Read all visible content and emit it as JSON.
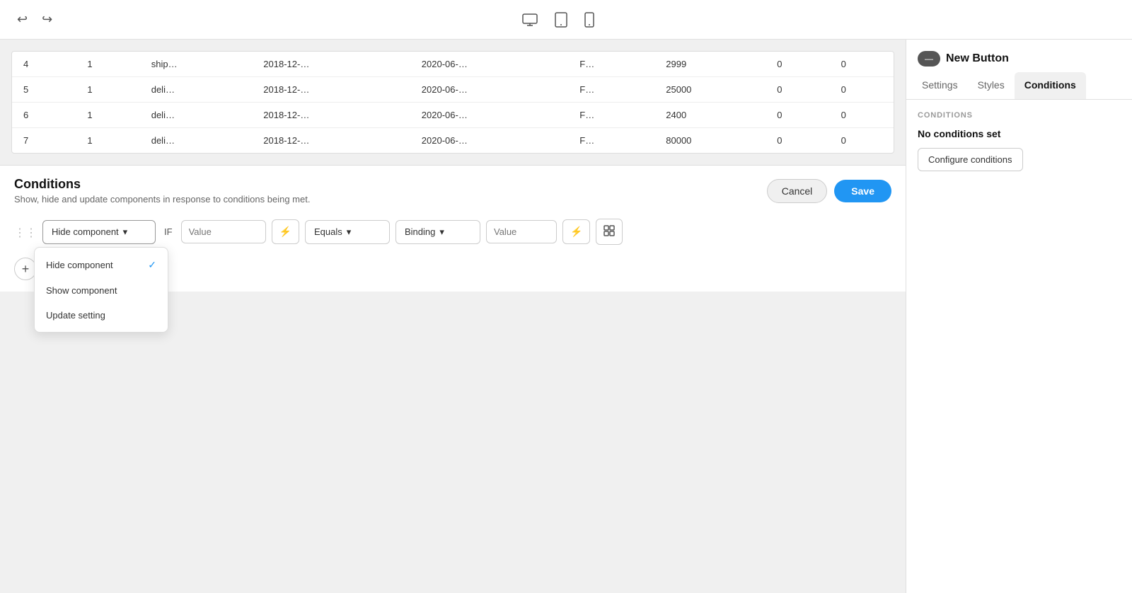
{
  "toolbar": {
    "undo_icon": "↩",
    "redo_icon": "↪",
    "device_desktop_icon": "🖥",
    "device_tablet_icon": "⬜",
    "device_mobile_icon": "📱"
  },
  "table": {
    "rows": [
      {
        "col1": "4",
        "col2": "1",
        "col3": "ship…",
        "col4": "2018-12-…",
        "col5": "2020-06-…",
        "col6": "F…",
        "col7": "2999",
        "col8": "0",
        "col9": "0"
      },
      {
        "col1": "5",
        "col2": "1",
        "col3": "deli…",
        "col4": "2018-12-…",
        "col5": "2020-06-…",
        "col6": "F…",
        "col7": "25000",
        "col8": "0",
        "col9": "0"
      },
      {
        "col1": "6",
        "col2": "1",
        "col3": "deli…",
        "col4": "2018-12-…",
        "col5": "2020-06-…",
        "col6": "F…",
        "col7": "2400",
        "col8": "0",
        "col9": "0"
      },
      {
        "col1": "7",
        "col2": "1",
        "col3": "deli…",
        "col4": "2018-12-…",
        "col5": "2020-06-…",
        "col6": "F…",
        "col7": "80000",
        "col8": "0",
        "col9": "0"
      }
    ]
  },
  "conditions_panel": {
    "title": "Conditions",
    "subtitle": "Show, hide and update components in response to conditions being met.",
    "cancel_label": "Cancel",
    "save_label": "Save"
  },
  "condition_row": {
    "dropdown_label": "Hide component",
    "if_label": "IF",
    "value_placeholder": "Value",
    "lightning_icon": "⚡",
    "equals_label": "Equals",
    "binding_label": "Binding",
    "value2_placeholder": "Value",
    "grid_icon": "⊞"
  },
  "dropdown_menu": {
    "items": [
      {
        "label": "Hide component",
        "selected": true
      },
      {
        "label": "Show component",
        "selected": false
      },
      {
        "label": "Update setting",
        "selected": false
      }
    ]
  },
  "add_button": {
    "icon": "+"
  },
  "right_panel": {
    "button_icon": "—",
    "button_label": "New Button",
    "tabs": [
      {
        "label": "Settings",
        "active": false
      },
      {
        "label": "Styles",
        "active": false
      },
      {
        "label": "Conditions",
        "active": true
      }
    ],
    "conditions_section_label": "CONDITIONS",
    "no_conditions_text": "No conditions set",
    "configure_label": "Configure conditions"
  }
}
